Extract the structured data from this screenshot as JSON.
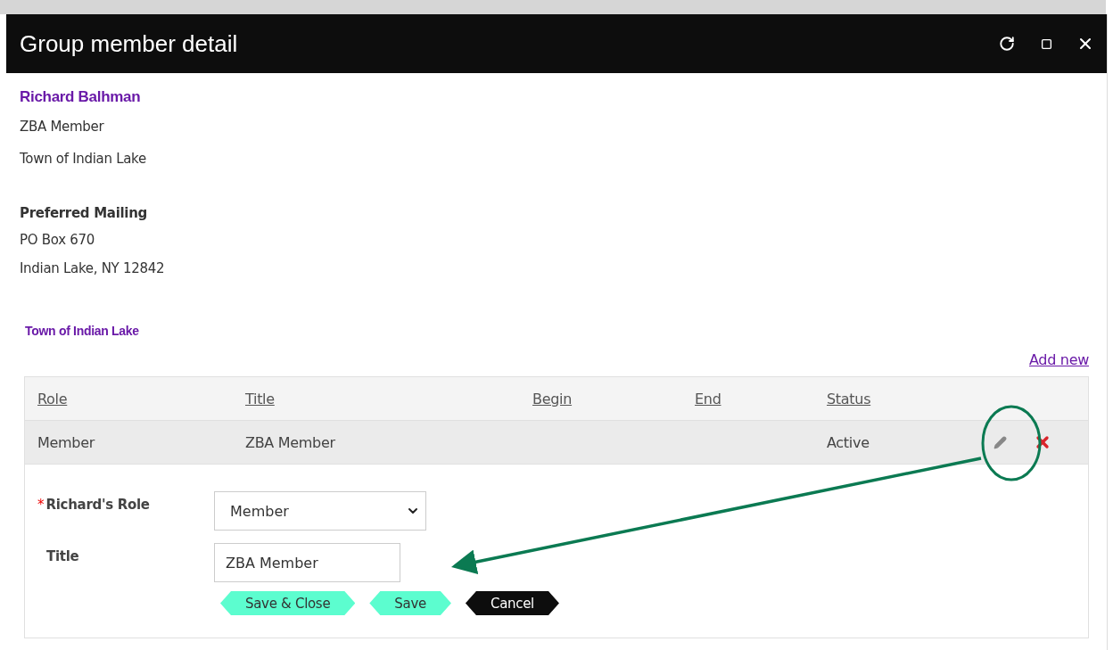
{
  "window": {
    "title": "Group member detail"
  },
  "contact": {
    "name": "Richard Balhman",
    "title": "ZBA Member",
    "organization": "Town of Indian Lake",
    "address_label": "Preferred Mailing",
    "address_lines": [
      "PO Box 670",
      "Indian Lake, NY 12842"
    ]
  },
  "group": {
    "name": "Town of Indian Lake",
    "add_link": "Add new"
  },
  "table": {
    "columns": [
      "Role",
      "Title",
      "Begin",
      "End",
      "Status"
    ],
    "rows": [
      {
        "cells": [
          "Member",
          "ZBA Member",
          "",
          "",
          "Active"
        ],
        "selected": true
      }
    ]
  },
  "form": {
    "required_mark": "*",
    "fields": [
      {
        "kind": "select",
        "label": "Richard's Role",
        "required": true,
        "value": "Member"
      },
      {
        "kind": "text",
        "label": "Title",
        "required": false,
        "value": "ZBA Member"
      }
    ],
    "buttons": [
      {
        "label": "Save & Close",
        "kind": "primary"
      },
      {
        "label": "Save",
        "kind": "primary"
      },
      {
        "label": "Cancel",
        "kind": "dark"
      }
    ]
  }
}
